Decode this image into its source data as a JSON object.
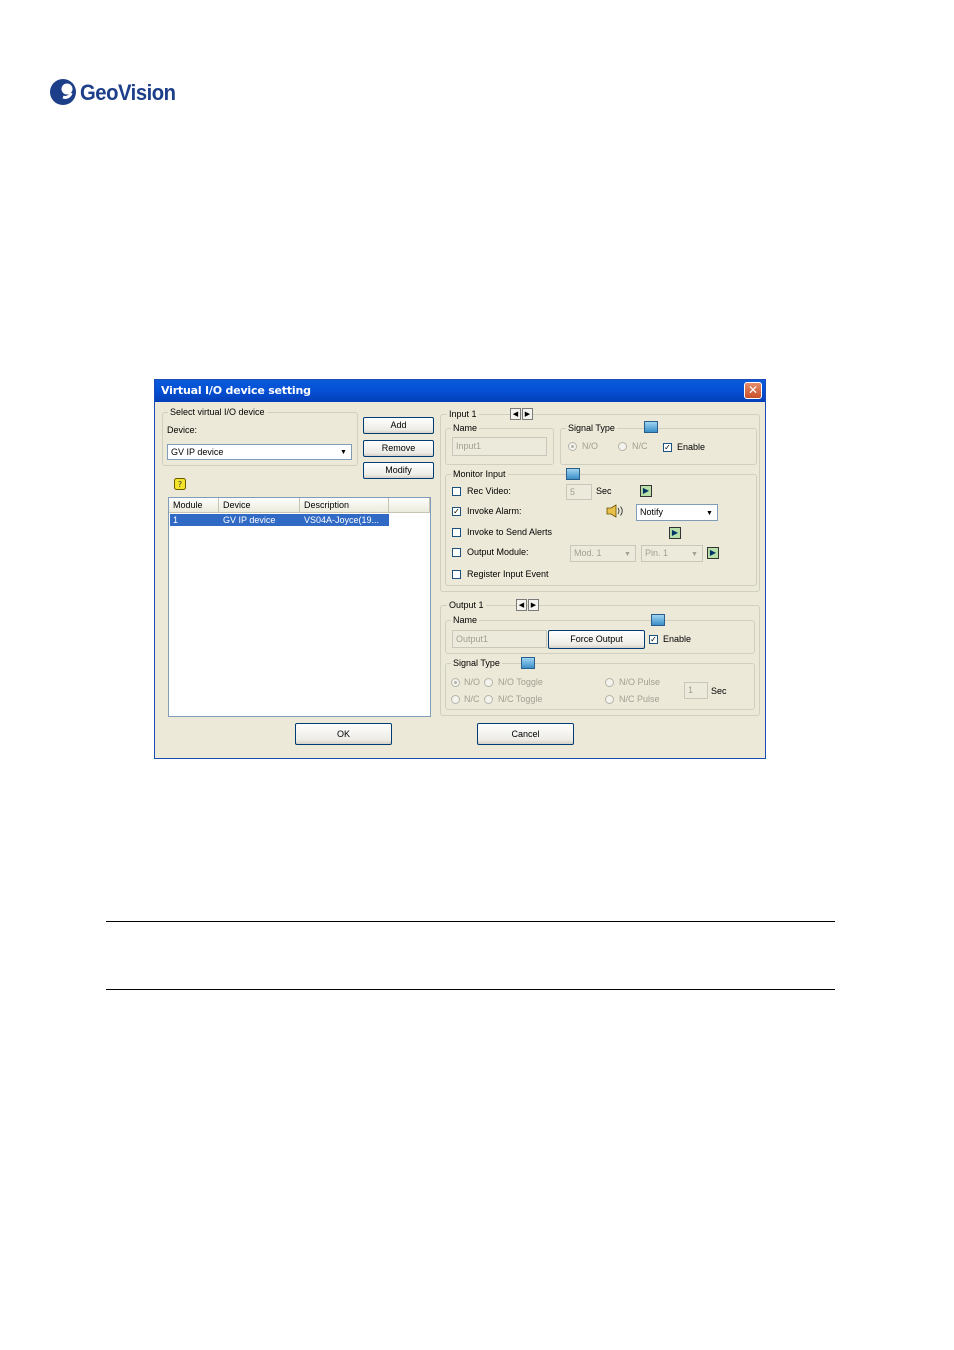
{
  "brand": {
    "name": "GeoVision",
    "colors": {
      "brand": "#1d3f8a"
    }
  },
  "dialog": {
    "title": "Virtual I/O device setting",
    "close_icon": "close-icon",
    "select_group": {
      "legend": "Select virtual I/O device",
      "device_label": "Device:",
      "device_value": "GV IP device"
    },
    "buttons": {
      "add": "Add",
      "remove": "Remove",
      "modify": "Modify",
      "ok": "OK",
      "cancel": "Cancel"
    },
    "list": {
      "columns": [
        "Module",
        "Device",
        "Description"
      ],
      "rows": [
        {
          "module": "1",
          "device": "GV IP device",
          "description": "VS04A-Joyce(19..."
        }
      ]
    },
    "input": {
      "legend": "Input 1",
      "name_legend": "Name",
      "name_value": "Input1",
      "signal_type_legend": "Signal Type",
      "no_label": "N/O",
      "nc_label": "N/C",
      "enable_label": "Enable",
      "monitor_legend": "Monitor Input",
      "rec_video": "Rec Video:",
      "rec_seconds": "5",
      "sec_label": "Sec",
      "invoke_alarm": "Invoke Alarm:",
      "alarm_value": "Notify",
      "invoke_alerts": "Invoke to Send Alerts",
      "output_module": "Output Module:",
      "mod_value": "Mod. 1",
      "pin_value": "Pin. 1",
      "register_event": "Register Input Event"
    },
    "output": {
      "legend": "Output 1",
      "name_legend": "Name",
      "name_value": "Output1",
      "force_output": "Force Output",
      "enable_label": "Enable",
      "signal_type_legend": "Signal Type",
      "no": "N/O",
      "no_toggle": "N/O Toggle",
      "nc": "N/C",
      "nc_toggle": "N/C Toggle",
      "no_pulse": "N/O Pulse",
      "nc_pulse": "N/C Pulse",
      "pulse_seconds": "1",
      "sec_label": "Sec"
    }
  }
}
